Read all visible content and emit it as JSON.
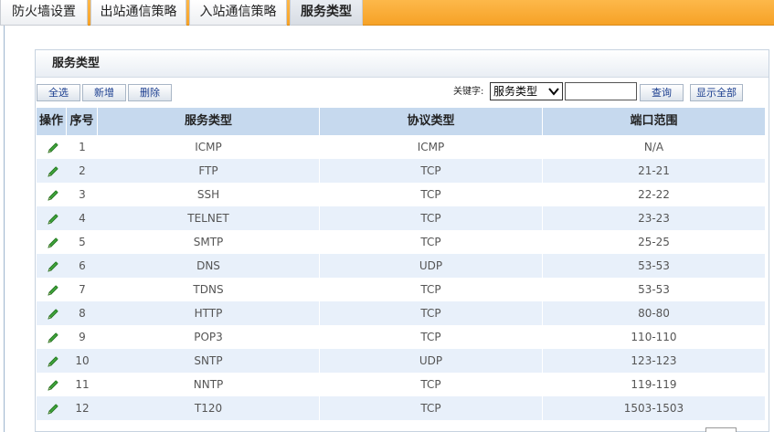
{
  "tabs": [
    {
      "label": "防火墙设置"
    },
    {
      "label": "出站通信策略"
    },
    {
      "label": "入站通信策略"
    },
    {
      "label": "服务类型"
    }
  ],
  "panel": {
    "title": "服务类型"
  },
  "toolbar": {
    "select_all": "全选",
    "add": "新增",
    "delete": "删除",
    "keyword_label": "关键字:",
    "keyword_select": "服务类型",
    "keyword_value": "",
    "search": "查询",
    "show_all": "显示全部"
  },
  "table": {
    "headers": {
      "op": "操作",
      "no": "序号",
      "service": "服务类型",
      "protocol": "协议类型",
      "ports": "端口范围"
    },
    "rows": [
      {
        "no": "1",
        "service": "ICMP",
        "protocol": "ICMP",
        "ports": "N/A"
      },
      {
        "no": "2",
        "service": "FTP",
        "protocol": "TCP",
        "ports": "21-21"
      },
      {
        "no": "3",
        "service": "SSH",
        "protocol": "TCP",
        "ports": "22-22"
      },
      {
        "no": "4",
        "service": "TELNET",
        "protocol": "TCP",
        "ports": "23-23"
      },
      {
        "no": "5",
        "service": "SMTP",
        "protocol": "TCP",
        "ports": "25-25"
      },
      {
        "no": "6",
        "service": "DNS",
        "protocol": "UDP",
        "ports": "53-53"
      },
      {
        "no": "7",
        "service": "TDNS",
        "protocol": "TCP",
        "ports": "53-53"
      },
      {
        "no": "8",
        "service": "HTTP",
        "protocol": "TCP",
        "ports": "80-80"
      },
      {
        "no": "9",
        "service": "POP3",
        "protocol": "TCP",
        "ports": "110-110"
      },
      {
        "no": "10",
        "service": "SNTP",
        "protocol": "UDP",
        "ports": "123-123"
      },
      {
        "no": "11",
        "service": "NNTP",
        "protocol": "TCP",
        "ports": "119-119"
      },
      {
        "no": "12",
        "service": "T120",
        "protocol": "TCP",
        "ports": "1503-1503"
      }
    ]
  },
  "icons": {
    "edit": "pencil-icon",
    "dropdown": "chevron-down-icon"
  },
  "colors": {
    "tabbar": "#f6a227",
    "header_bg": "#c6d9ee",
    "row_alt": "#e8f0fa",
    "link_text": "#1a3d8f"
  }
}
